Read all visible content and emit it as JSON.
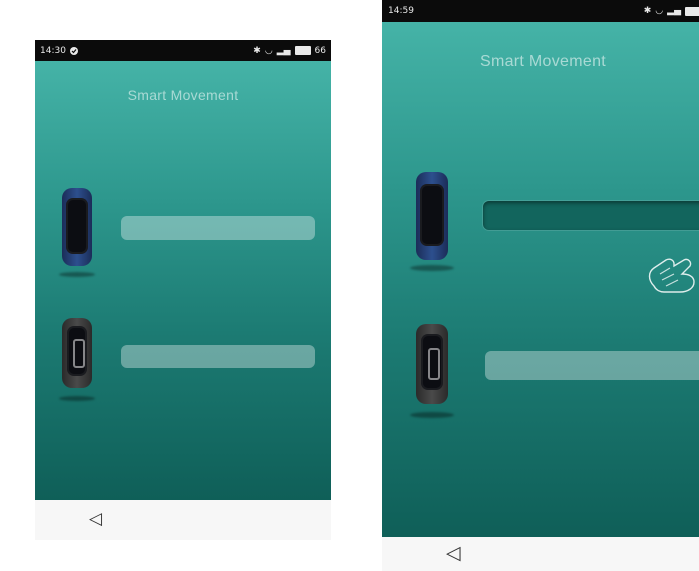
{
  "left_phone": {
    "status_bar": {
      "time": "14:30",
      "right_text": "66"
    },
    "title": "Smart Movement",
    "devices": [
      {
        "band": "blue-band",
        "bar_state": "normal"
      },
      {
        "band": "dark-band",
        "bar_state": "normal"
      }
    ],
    "nav": {
      "back_icon": "◁"
    }
  },
  "right_phone": {
    "status_bar": {
      "time": "14:59"
    },
    "title": "Smart Movement",
    "devices": [
      {
        "band": "blue-band",
        "bar_state": "pressed"
      },
      {
        "band": "dark-band",
        "bar_state": "normal"
      }
    ],
    "gesture_icon": "tap-hand-icon",
    "nav": {
      "back_icon": "◁"
    }
  },
  "colors": {
    "gradient_top": "#45b3a7",
    "gradient_bottom": "#0f5f58",
    "status_bar": "#0b0b0b",
    "bar_normal": "rgba(255,255,255,0.35)",
    "bar_pressed": "#12655d"
  }
}
